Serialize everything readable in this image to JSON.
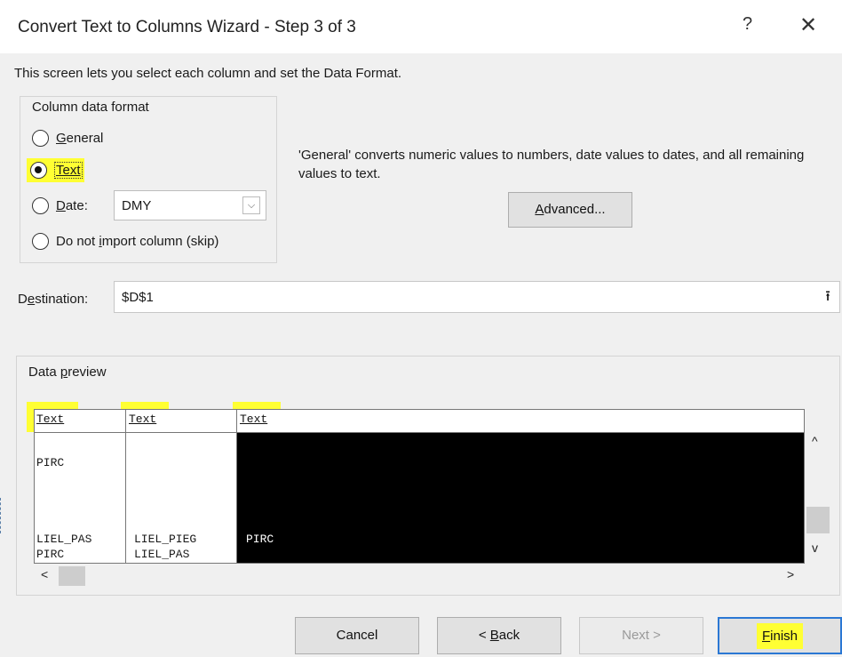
{
  "window": {
    "title": "Convert Text to Columns Wizard - Step 3 of 3",
    "help_label": "?",
    "close_label": "✕"
  },
  "intro": "This screen lets you select each column and set the Data Format.",
  "column_format": {
    "legend": "Column data format",
    "options": [
      {
        "label": "General",
        "checked": false
      },
      {
        "label": "Text",
        "checked": true
      },
      {
        "label": "Date:",
        "checked": false
      },
      {
        "label": "Do not import column (skip)",
        "checked": false
      }
    ],
    "date_value": "DMY",
    "date_chevron": "⌵"
  },
  "info_text": "'General' converts numeric values to numbers, date values to dates, and all remaining values to text.",
  "advanced_label": "Advanced...",
  "destination": {
    "label": "Destination:",
    "value": "$D$1",
    "collapse_icon": "⭱"
  },
  "preview": {
    "legend": "Data preview",
    "headers": [
      "Text",
      "Text",
      "Text"
    ],
    "rows": [
      [
        "PIRC",
        "",
        ""
      ],
      [
        "",
        "",
        ""
      ],
      [
        "",
        "",
        ""
      ],
      [
        "LIEL_PAS",
        "LIEL_PIEG",
        "PIRC"
      ],
      [
        "PIRC",
        "LIEL_PAS",
        ""
      ]
    ],
    "scroll_up": "^",
    "scroll_down": "v",
    "scroll_left": "<",
    "scroll_right": ">"
  },
  "buttons": {
    "cancel": "Cancel",
    "back": "< Back",
    "next": "Next >",
    "finish": "Finish"
  },
  "colors": {
    "highlight": "#ffff33",
    "focus_border": "#2b78d4"
  }
}
